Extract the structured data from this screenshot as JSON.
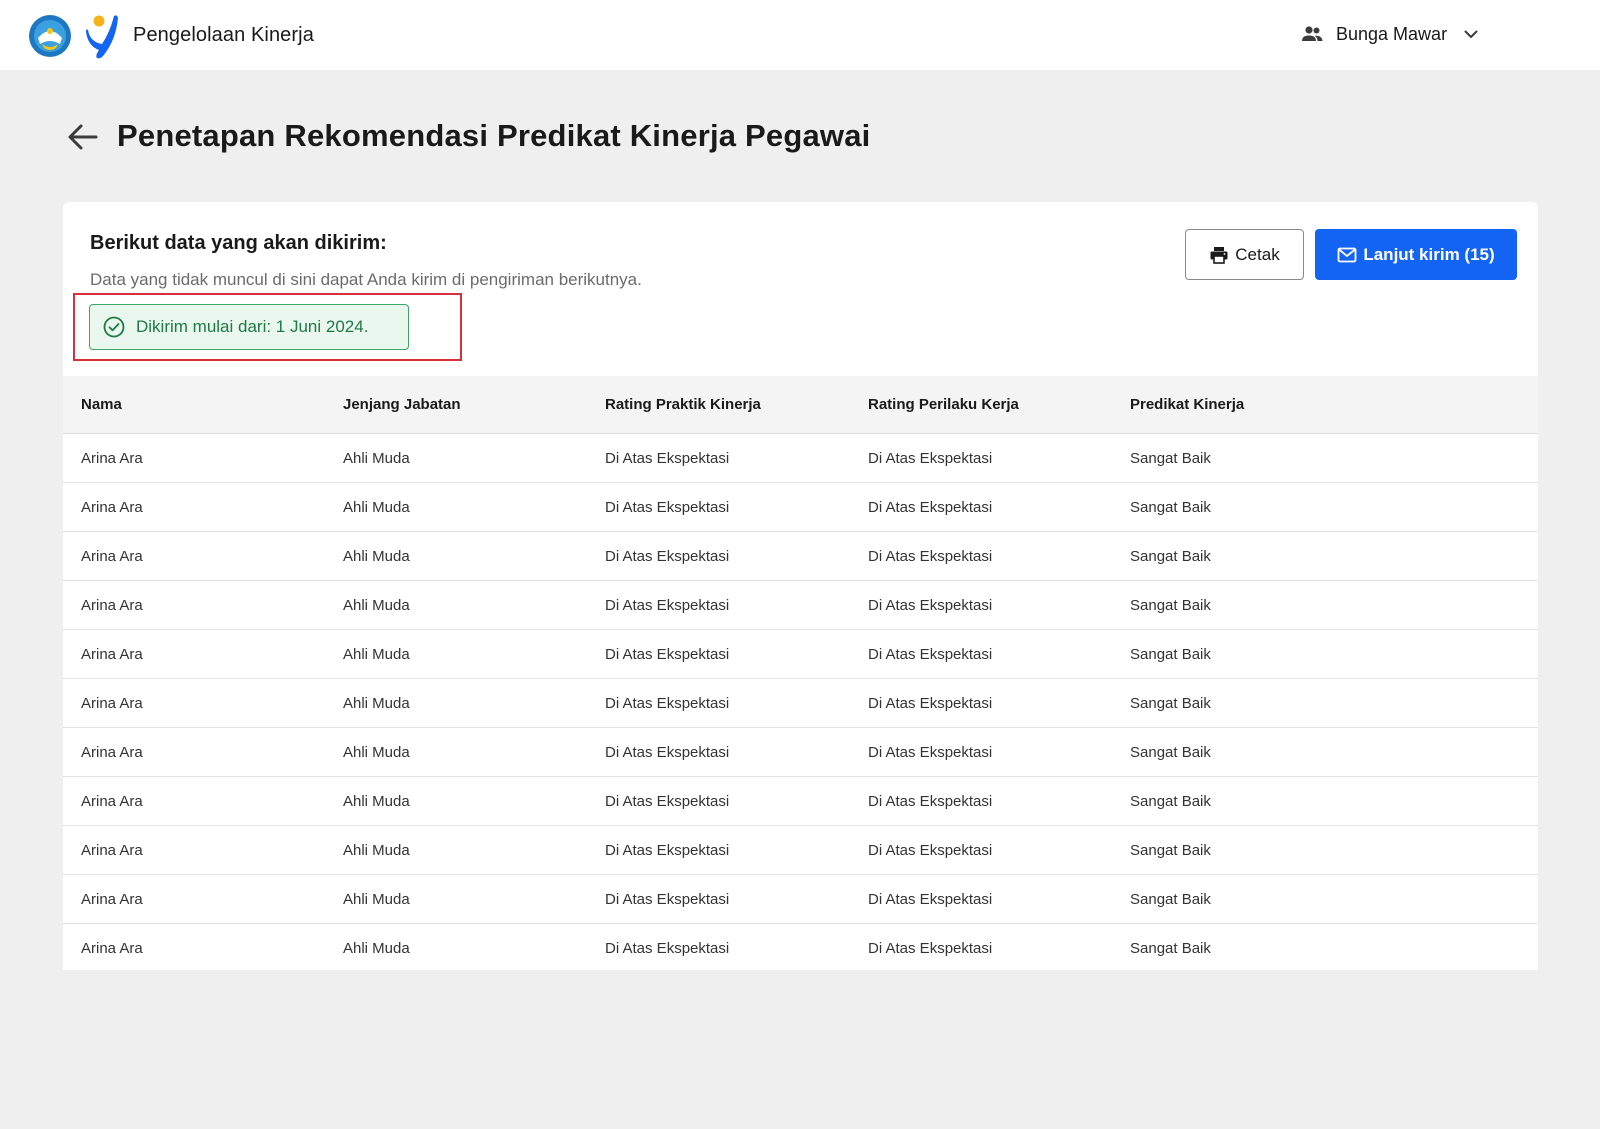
{
  "app": {
    "title": "Pengelolaan Kinerja",
    "user_name": "Bunga Mawar"
  },
  "page": {
    "title": "Penetapan Rekomendasi Predikat Kinerja Pegawai"
  },
  "card": {
    "heading": "Berikut data yang akan dikirim:",
    "subtitle": "Data yang tidak muncul di sini dapat Anda kirim di pengiriman berikutnya.",
    "notice": "Dikirim mulai dari: 1 Juni 2024.",
    "print_label": "Cetak",
    "send_label": "Lanjut kirim (15)"
  },
  "colors": {
    "primary": "#1464f4",
    "success_bg": "#e9f7ee",
    "success_border": "#3aa565",
    "success_text": "#1f7a45",
    "highlight": "#d9313a"
  },
  "icons": {
    "back": "arrow-left-icon",
    "user": "people-icon",
    "dropdown": "chevron-down-icon",
    "notice": "check-circle-icon",
    "print": "printer-icon",
    "send": "mail-icon"
  },
  "table": {
    "headers": [
      "Nama",
      "Jenjang Jabatan",
      "Rating Praktik Kinerja",
      "Rating Perilaku Kerja",
      "Predikat Kinerja"
    ],
    "rows": [
      [
        "Arina Ara",
        "Ahli Muda",
        "Di Atas Ekspektasi",
        "Di Atas Ekspektasi",
        "Sangat Baik"
      ],
      [
        "Arina Ara",
        "Ahli Muda",
        "Di Atas Ekspektasi",
        "Di Atas Ekspektasi",
        "Sangat Baik"
      ],
      [
        "Arina Ara",
        "Ahli Muda",
        "Di Atas Ekspektasi",
        "Di Atas Ekspektasi",
        "Sangat Baik"
      ],
      [
        "Arina Ara",
        "Ahli Muda",
        "Di Atas Ekspektasi",
        "Di Atas Ekspektasi",
        "Sangat Baik"
      ],
      [
        "Arina Ara",
        "Ahli Muda",
        "Di Atas Ekspektasi",
        "Di Atas Ekspektasi",
        "Sangat Baik"
      ],
      [
        "Arina Ara",
        "Ahli Muda",
        "Di Atas Ekspektasi",
        "Di Atas Ekspektasi",
        "Sangat Baik"
      ],
      [
        "Arina Ara",
        "Ahli Muda",
        "Di Atas Ekspektasi",
        "Di Atas Ekspektasi",
        "Sangat Baik"
      ],
      [
        "Arina Ara",
        "Ahli Muda",
        "Di Atas Ekspektasi",
        "Di Atas Ekspektasi",
        "Sangat Baik"
      ],
      [
        "Arina Ara",
        "Ahli Muda",
        "Di Atas Ekspektasi",
        "Di Atas Ekspektasi",
        "Sangat Baik"
      ],
      [
        "Arina Ara",
        "Ahli Muda",
        "Di Atas Ekspektasi",
        "Di Atas Ekspektasi",
        "Sangat Baik"
      ],
      [
        "Arina Ara",
        "Ahli Muda",
        "Di Atas Ekspektasi",
        "Di Atas Ekspektasi",
        "Sangat Baik"
      ]
    ]
  }
}
